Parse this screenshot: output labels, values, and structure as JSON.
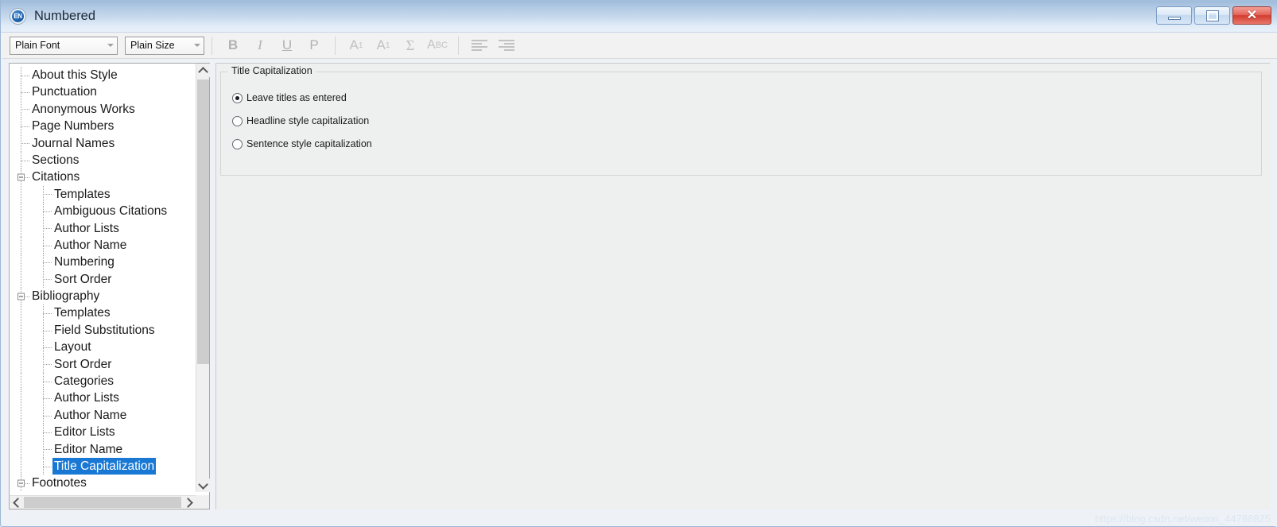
{
  "window": {
    "title": "Numbered",
    "app_icon": "endnote-en-icon",
    "app_icon_text": "EN",
    "buttons": {
      "minimize": "minimize-icon",
      "maximize": "maximize-icon",
      "close": "close-icon",
      "close_glyph": "✕"
    }
  },
  "toolbar": {
    "font_combo": {
      "value": "Plain Font",
      "placeholder": "Plain Font"
    },
    "size_combo": {
      "value": "Plain Size",
      "placeholder": "Plain Size"
    },
    "buttons": [
      {
        "name": "bold-button",
        "label": "B"
      },
      {
        "name": "italic-button",
        "label": "I"
      },
      {
        "name": "underline-button",
        "label": "U"
      },
      {
        "name": "plain-button",
        "label": "P"
      },
      {
        "name": "superscript-button",
        "label": "A",
        "script": "1"
      },
      {
        "name": "subscript-button",
        "label": "A",
        "script": "1"
      },
      {
        "name": "symbol-button",
        "label": "Σ"
      },
      {
        "name": "smallcaps-button",
        "label": "A",
        "script": "BC"
      },
      {
        "name": "align-left-button",
        "label": ""
      },
      {
        "name": "align-right-button",
        "label": ""
      }
    ]
  },
  "tree": {
    "items": [
      {
        "label": "About this Style",
        "level": 0,
        "expander": false,
        "selected": false
      },
      {
        "label": "Punctuation",
        "level": 0,
        "expander": false,
        "selected": false
      },
      {
        "label": "Anonymous Works",
        "level": 0,
        "expander": false,
        "selected": false
      },
      {
        "label": "Page Numbers",
        "level": 0,
        "expander": false,
        "selected": false
      },
      {
        "label": "Journal Names",
        "level": 0,
        "expander": false,
        "selected": false
      },
      {
        "label": "Sections",
        "level": 0,
        "expander": false,
        "selected": false
      },
      {
        "label": "Citations",
        "level": 0,
        "expander": true,
        "selected": false
      },
      {
        "label": "Templates",
        "level": 1,
        "expander": false,
        "selected": false
      },
      {
        "label": "Ambiguous Citations",
        "level": 1,
        "expander": false,
        "selected": false
      },
      {
        "label": "Author Lists",
        "level": 1,
        "expander": false,
        "selected": false
      },
      {
        "label": "Author Name",
        "level": 1,
        "expander": false,
        "selected": false
      },
      {
        "label": "Numbering",
        "level": 1,
        "expander": false,
        "selected": false
      },
      {
        "label": "Sort Order",
        "level": 1,
        "expander": false,
        "selected": false
      },
      {
        "label": "Bibliography",
        "level": 0,
        "expander": true,
        "selected": false
      },
      {
        "label": "Templates",
        "level": 1,
        "expander": false,
        "selected": false
      },
      {
        "label": "Field Substitutions",
        "level": 1,
        "expander": false,
        "selected": false
      },
      {
        "label": "Layout",
        "level": 1,
        "expander": false,
        "selected": false
      },
      {
        "label": "Sort Order",
        "level": 1,
        "expander": false,
        "selected": false
      },
      {
        "label": "Categories",
        "level": 1,
        "expander": false,
        "selected": false
      },
      {
        "label": "Author Lists",
        "level": 1,
        "expander": false,
        "selected": false
      },
      {
        "label": "Author Name",
        "level": 1,
        "expander": false,
        "selected": false
      },
      {
        "label": "Editor Lists",
        "level": 1,
        "expander": false,
        "selected": false
      },
      {
        "label": "Editor Name",
        "level": 1,
        "expander": false,
        "selected": false
      },
      {
        "label": "Title Capitalization",
        "level": 1,
        "expander": false,
        "selected": true
      },
      {
        "label": "Footnotes",
        "level": 0,
        "expander": true,
        "selected": false
      }
    ],
    "selection_color": "#1878d4"
  },
  "panel": {
    "group_title": "Title Capitalization",
    "options": [
      {
        "label": "Leave titles as entered",
        "checked": true
      },
      {
        "label": "Headline style capitalization",
        "checked": false
      },
      {
        "label": "Sentence style capitalization",
        "checked": false
      }
    ]
  },
  "watermark": "https://blog.csdn.net/weixin_44788825"
}
